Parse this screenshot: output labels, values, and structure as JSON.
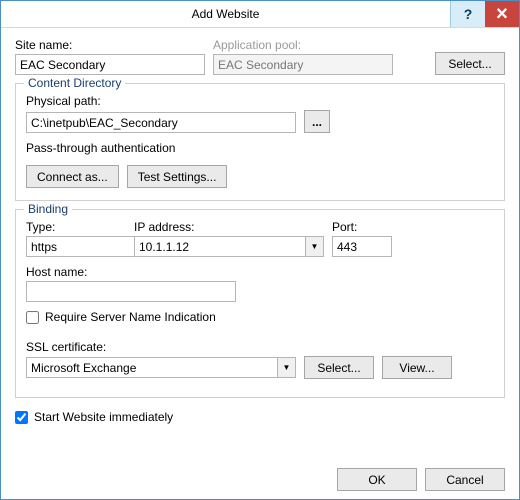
{
  "window": {
    "title": "Add Website",
    "help_icon": "?",
    "close_icon": "🗙"
  },
  "site": {
    "name_label": "Site name:",
    "name_value": "EAC Secondary",
    "apppool_label": "Application pool:",
    "apppool_value": "EAC Secondary",
    "select_button": "Select..."
  },
  "contentdir": {
    "group_label": "Content Directory",
    "path_label": "Physical path:",
    "path_value": "C:\\inetpub\\EAC_Secondary",
    "browse_button": "...",
    "passthrough_label": "Pass-through authentication",
    "connect_as": "Connect as...",
    "test_settings": "Test Settings..."
  },
  "binding": {
    "group_label": "Binding",
    "type_label": "Type:",
    "type_value": "https",
    "ip_label": "IP address:",
    "ip_value": "10.1.1.12",
    "port_label": "Port:",
    "port_value": "443",
    "host_label": "Host name:",
    "host_value": "",
    "sni_label": "Require Server Name Indication",
    "ssl_label": "SSL certificate:",
    "ssl_value": "Microsoft Exchange",
    "ssl_select": "Select...",
    "ssl_view": "View..."
  },
  "start_immediately_label": "Start Website immediately",
  "start_immediately_checked": true,
  "footer": {
    "ok": "OK",
    "cancel": "Cancel"
  }
}
